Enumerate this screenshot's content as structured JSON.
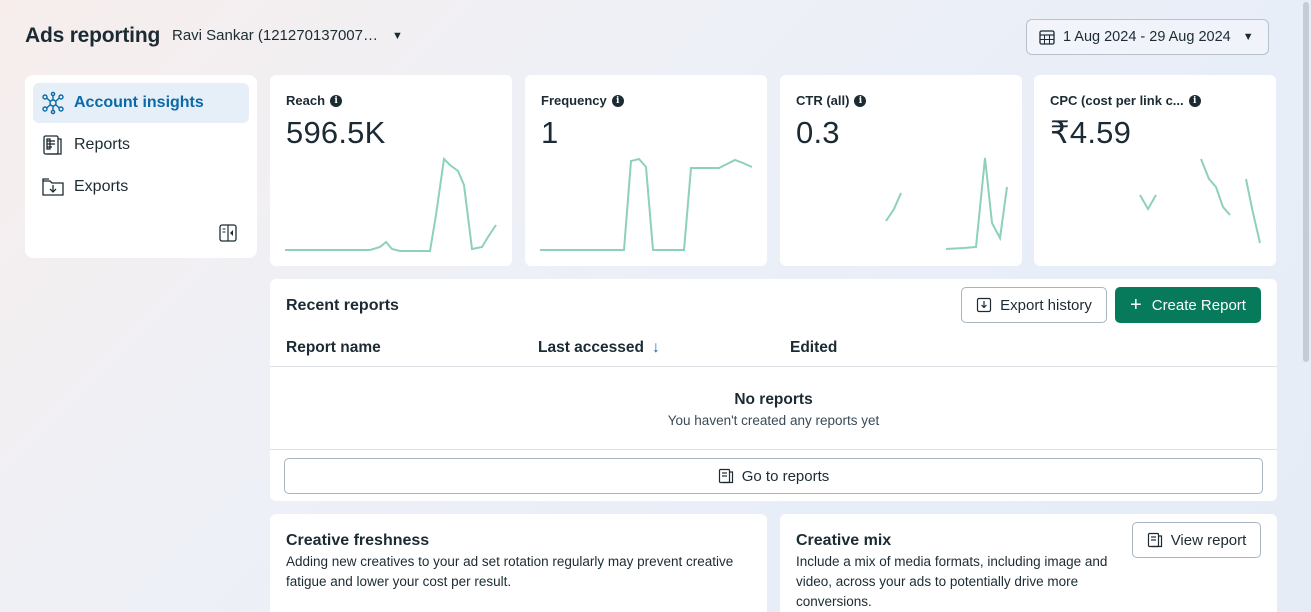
{
  "header": {
    "title": "Ads reporting",
    "account": "Ravi Sankar (121270137007…",
    "date_range": "1 Aug 2024 - 29 Aug 2024"
  },
  "sidebar": {
    "items": [
      {
        "label": "Account insights",
        "icon": "network-icon",
        "active": true
      },
      {
        "label": "Reports",
        "icon": "reports-icon",
        "active": false
      },
      {
        "label": "Exports",
        "icon": "export-folder-icon",
        "active": false
      }
    ],
    "collapse_icon": "collapse-panel-icon"
  },
  "metrics": [
    {
      "label": "Reach",
      "value": "596.5K"
    },
    {
      "label": "Frequency",
      "value": "1"
    },
    {
      "label": "CTR (all)",
      "value": "0.3"
    },
    {
      "label": "CPC (cost per link c...",
      "value": "₹4.59"
    }
  ],
  "recent_reports": {
    "title": "Recent reports",
    "export_history_label": "Export history",
    "create_report_label": "Create Report",
    "columns": [
      "Report name",
      "Last accessed",
      "Edited"
    ],
    "empty_title": "No reports",
    "empty_subtitle": "You haven't created any reports yet",
    "go_to_reports_label": "Go to reports"
  },
  "creative_freshness": {
    "title": "Creative freshness",
    "description": "Adding new creatives to your ad set rotation regularly may prevent creative fatigue and lower your cost per result."
  },
  "creative_mix": {
    "title": "Creative mix",
    "description": "Include a mix of media formats, including image and video, across your ads to potentially drive more conversions.",
    "view_report_label": "View report"
  },
  "colors": {
    "accent": "#0a6aa8",
    "primary_button": "#067a5a",
    "sparkline": "#8fd0b9"
  }
}
